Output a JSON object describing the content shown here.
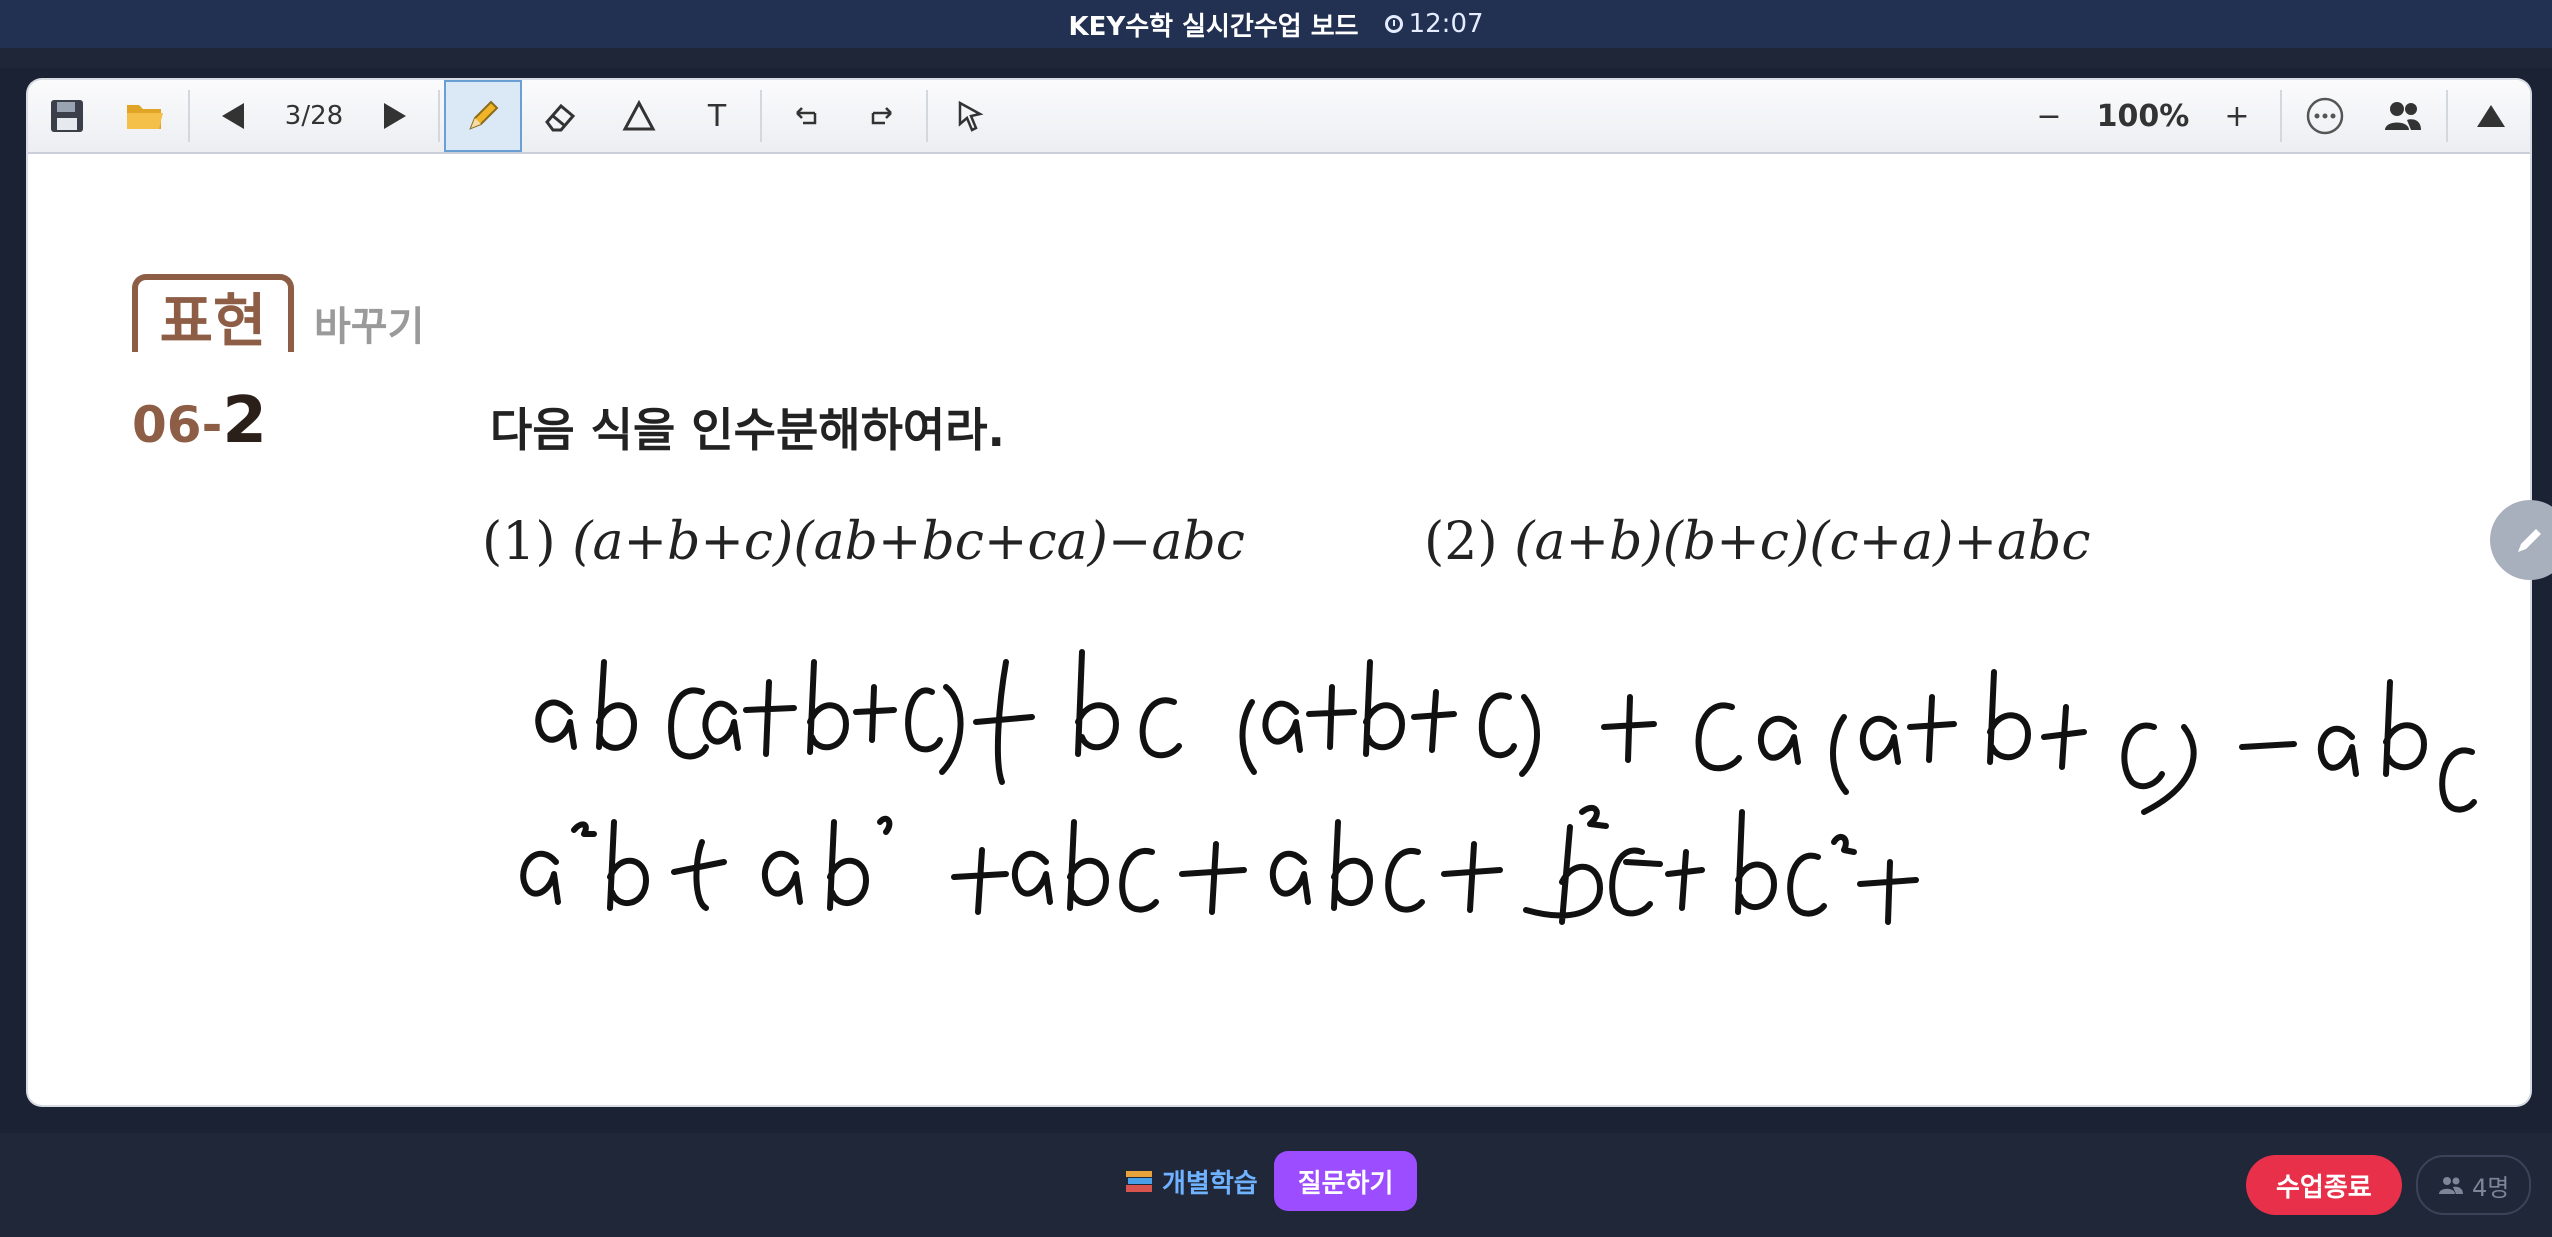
{
  "app": {
    "title": "KEY수학 실시간수업 보드",
    "timer": "12:07"
  },
  "toolbar": {
    "page_indicator": "3/28",
    "zoom": "100%",
    "zoom_out": "−",
    "zoom_in": "+",
    "text_tool": "T",
    "more": "···"
  },
  "content": {
    "badge": "표현",
    "badge_sub": "바꾸기",
    "problem_number_prefix": "06-",
    "problem_number": "2",
    "instruction": "다음 식을 인수분해하여라.",
    "sub1_label": "(1)",
    "sub1_expr": "(a+b+c)(ab+bc+ca)−abc",
    "sub2_label": "(2)",
    "sub2_expr": "(a+b)(b+c)(c+a)+abc"
  },
  "bottom": {
    "personal_study": "개별학습",
    "ask": "질문하기",
    "end_class": "수업종료",
    "participants": "4명"
  }
}
